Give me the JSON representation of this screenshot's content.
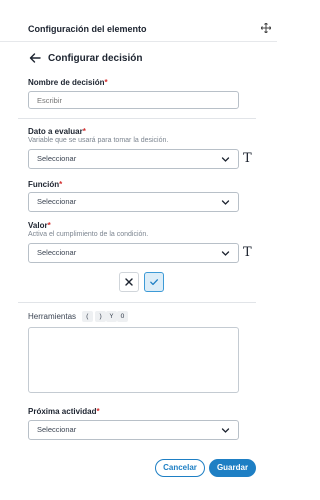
{
  "header": {
    "title": "Configuración del elemento"
  },
  "subheader": {
    "title": "Configurar decisión"
  },
  "decision_name": {
    "label": "Nombre de decisión",
    "placeholder": "Escribir",
    "value": ""
  },
  "data_to_evaluate": {
    "label": "Dato a evaluar",
    "helper": "Variable que se usará para tomar la desición.",
    "value": "Seleccionar"
  },
  "function": {
    "label": "Función",
    "value": "Seleccionar"
  },
  "value_field": {
    "label": "Valor",
    "helper": "Activa el cumplimiento de la condición.",
    "value": "Seleccionar"
  },
  "text_mode_glyph": "T",
  "tools": {
    "label": "Herramientas",
    "chips": [
      "(",
      ")",
      "Y",
      "O"
    ]
  },
  "next_activity": {
    "label": "Próxima actividad",
    "value": "Seleccionar"
  },
  "required_mark": "*",
  "buttons": {
    "cancel": "Cancelar",
    "save": "Guardar"
  },
  "colors": {
    "accent": "#1e7fc4",
    "required": "#d32f2f",
    "check_active_bg": "#dcedf8"
  },
  "icons": {
    "back": "arrow-left-icon",
    "chevron": "chevron-down-icon",
    "close": "close-icon",
    "check": "check-icon",
    "resize": "move-icon"
  }
}
